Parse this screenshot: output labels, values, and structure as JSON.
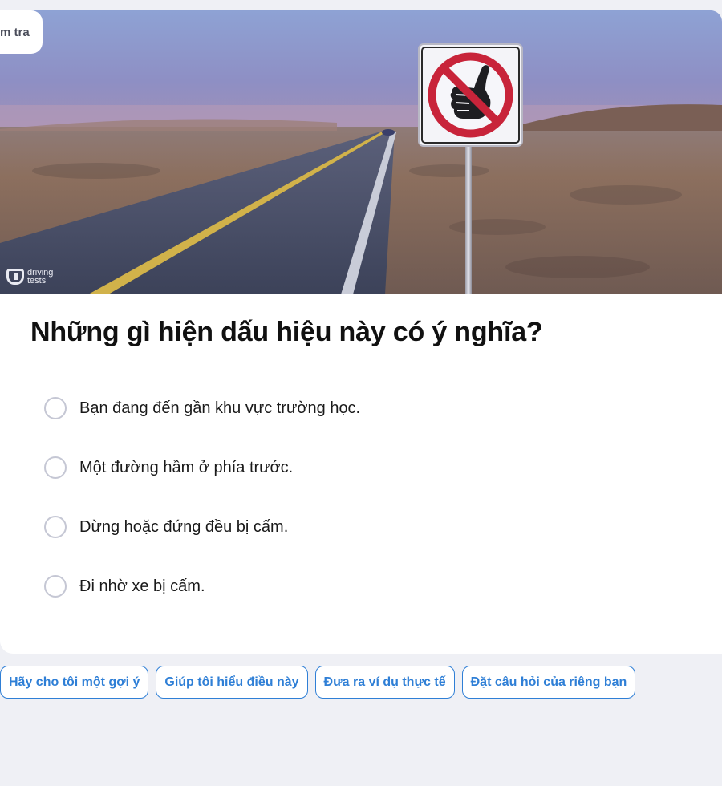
{
  "quiz_tag": "m tra",
  "hero": {
    "watermark_line1": "driving",
    "watermark_line2": "tests",
    "sign_icon": "no-hitchhiking-sign-icon"
  },
  "question": "Những gì hiện dấu hiệu này có ý nghĩa?",
  "options": [
    "Bạn đang đến gần khu vực trường học.",
    "Một đường hầm ở phía trước.",
    "Dừng hoặc đứng đều bị cấm.",
    "Đi nhờ xe bị cấm."
  ],
  "chips": [
    "Hãy cho tôi một gợi ý",
    "Giúp tôi hiểu điều này",
    "Đưa ra ví dụ thực tế",
    "Đặt câu hỏi của riêng bạn"
  ],
  "colors": {
    "background": "#eff0f5",
    "accent": "#2f7fd6",
    "radio_border": "#c5c7d4",
    "sign_red": "#c8243a"
  }
}
